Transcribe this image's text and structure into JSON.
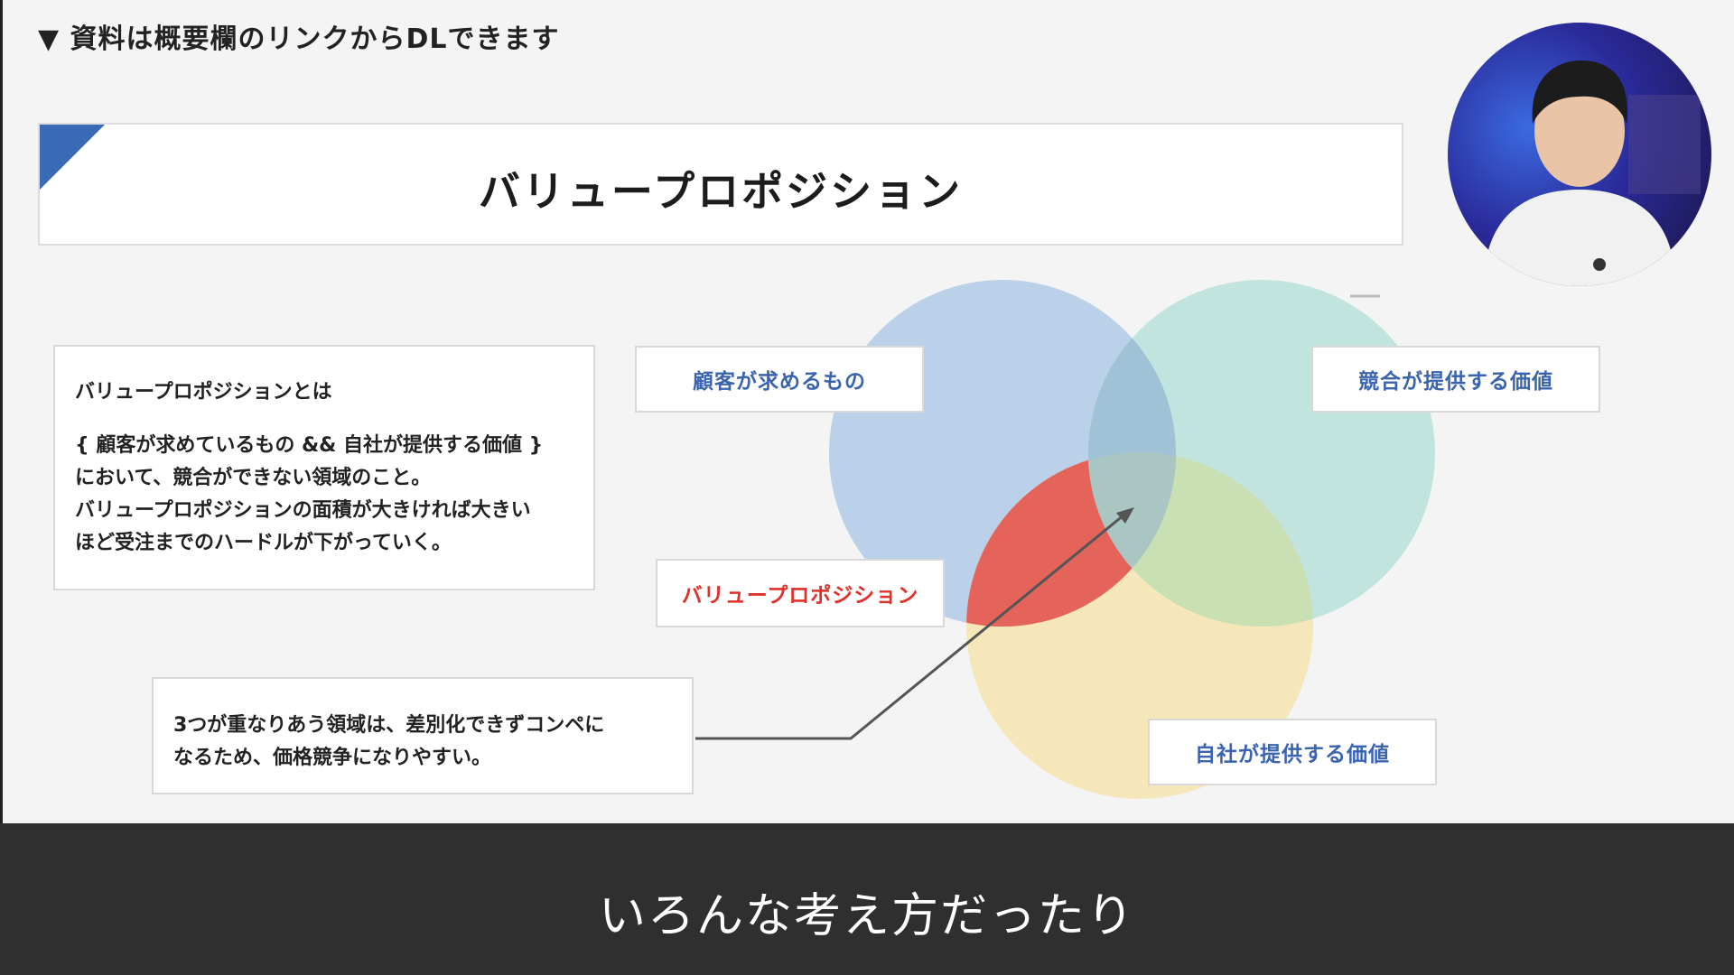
{
  "header": {
    "notice": "▼ 資料は概要欄のリンクからDLできます"
  },
  "slide": {
    "title": "バリュープロポジション",
    "definition": {
      "heading": "バリュープロポジションとは",
      "lines": [
        "{ 顧客が求めているもの && 自社が提供する価値 }",
        "において、競合ができない領域のこと。",
        "バリュープロポジションの面積が大きければ大きい",
        "ほど受注までのハードルが下がっていく。"
      ]
    },
    "venn": {
      "labels": {
        "customer": "顧客が求めるもの",
        "competitor": "競合が提供する価値",
        "own": "自社が提供する価値",
        "value_proposition": "バリュープロポジション"
      },
      "colors": {
        "customer": "#b7cfe8",
        "competitor": "#bfe3dc",
        "own": "#f6e6b7",
        "value_proposition": "#e4645a",
        "accent": "#3a6ab5"
      }
    },
    "note": {
      "lines": [
        "3つが重なりあう領域は、差別化できずコンペに",
        "なるため、価格競争になりやすい。"
      ]
    }
  },
  "subtitle": {
    "text": "いろんな考え方だったり"
  }
}
